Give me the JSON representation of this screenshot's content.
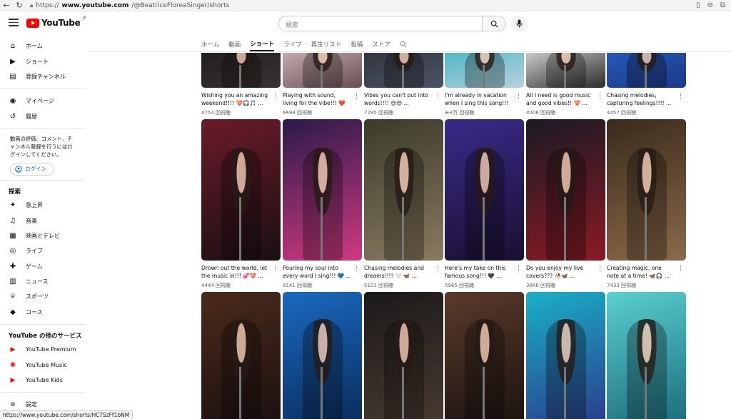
{
  "browser": {
    "url_prefix": "https://",
    "url_host": "www.youtube.com",
    "url_path": "/@BeatriceFloreaSinger/shorts"
  },
  "header": {
    "logo_text": "YouTube",
    "logo_region": "JP",
    "search_placeholder": "検索"
  },
  "sidebar": {
    "main": [
      {
        "label": "ホーム",
        "icon": "home-icon"
      },
      {
        "label": "ショート",
        "icon": "shorts-icon"
      },
      {
        "label": "登録チャンネル",
        "icon": "subscriptions-icon"
      }
    ],
    "you": [
      {
        "label": "マイページ",
        "icon": "account-icon"
      },
      {
        "label": "履歴",
        "icon": "history-icon"
      }
    ],
    "signin_note": "動画の評価、コメント、チャンネル登録を行うにはログインしてください。",
    "login_label": "ログイン",
    "explore_heading": "探索",
    "explore": [
      {
        "label": "急上昇",
        "icon": "trending-icon"
      },
      {
        "label": "音楽",
        "icon": "music-icon"
      },
      {
        "label": "映画とテレビ",
        "icon": "movies-icon"
      },
      {
        "label": "ライブ",
        "icon": "live-icon"
      },
      {
        "label": "ゲーム",
        "icon": "gaming-icon"
      },
      {
        "label": "ニュース",
        "icon": "news-icon"
      },
      {
        "label": "スポーツ",
        "icon": "sports-icon"
      },
      {
        "label": "コース",
        "icon": "courses-icon"
      }
    ],
    "more_heading": "YouTube の他のサービス",
    "more": [
      {
        "label": "YouTube Premium",
        "icon": "youtube-premium-icon"
      },
      {
        "label": "YouTube Music",
        "icon": "youtube-music-icon"
      },
      {
        "label": "YouTube Kids",
        "icon": "youtube-kids-icon"
      }
    ],
    "settings_label": "設定"
  },
  "tabs": [
    {
      "label": "ホーム",
      "active": false
    },
    {
      "label": "動画",
      "active": false
    },
    {
      "label": "ショート",
      "active": true
    },
    {
      "label": "ライブ",
      "active": false
    },
    {
      "label": "再生リスト",
      "active": false
    },
    {
      "label": "投稿",
      "active": false
    },
    {
      "label": "ストア",
      "active": false
    }
  ],
  "shorts_rows": [
    [
      {
        "title": "Wishing you an amazing weekend!!!! 💝🎧🎵 ...",
        "views": "4754 回視聴",
        "c1": "#1a1a1a",
        "c2": "#3a3232"
      },
      {
        "title": "Playing with sound, living for the vibe!!! ❤️ ...",
        "views": "5598 回視聴",
        "c1": "#d8c0c4",
        "c2": "#6a4e52"
      },
      {
        "title": "Vibes you can't put into words!!!! 😍😍 ...",
        "views": "7295 回視聴",
        "c1": "#2e2e34",
        "c2": "#4a5466"
      },
      {
        "title": "I'm already in vacation when I sing this song!!! ...",
        "views": "1.3万 回視聴",
        "c1": "#3ab0c6",
        "c2": "#b8d2da"
      },
      {
        "title": "All I need is good music and good vibes!! 💝 ...",
        "views": "4006 回視聴",
        "c1": "#f0f0f0",
        "c2": "#2a2a2a"
      },
      {
        "title": "Chasing melodies, capturing feelings!!!! ...",
        "views": "4457 回視聴",
        "c1": "#2a5fc0",
        "c2": "#1a3a8a"
      }
    ],
    [
      {
        "title": "Drown out the world, let the music in!!! 💞💝 ...",
        "views": "4444 回視聴",
        "c1": "#6a1a2a",
        "c2": "#1a1012"
      },
      {
        "title": "Pouring my soul into every word I sing!!! 💙 ...",
        "views": "8141 回視聴",
        "c1": "#2a1a4a",
        "c2": "#d03a80"
      },
      {
        "title": "Chasing melodies and dreams!!!! 🤍 🦋 ...",
        "views": "5101 回視聴",
        "c1": "#3a3a2a",
        "c2": "#8a7a60"
      },
      {
        "title": "Here's my take on this famous song!!! 🖤 ...",
        "views": "5985 回視聴",
        "c1": "#3a2a8a",
        "c2": "#1a1030"
      },
      {
        "title": "Do you enjoy my live covers??? 🥀🦋 ...",
        "views": "3666 回視聴",
        "c1": "#1a1a24",
        "c2": "#8a1a24"
      },
      {
        "title": "Creating magic, one note at a time! 🦋🎧 ...",
        "views": "7433 回視聴",
        "c1": "#3a2a1a",
        "c2": "#8a6a4a"
      }
    ],
    [
      {
        "title": "",
        "views": "",
        "c1": "#4a2a1a",
        "c2": "#1a1010"
      },
      {
        "title": "",
        "views": "",
        "c1": "#1a6ac0",
        "c2": "#0a2a5a"
      },
      {
        "title": "",
        "views": "",
        "c1": "#1a1a1a",
        "c2": "#4a3a30"
      },
      {
        "title": "",
        "views": "",
        "c1": "#5a3a2a",
        "c2": "#1a1210"
      },
      {
        "title": "",
        "views": "",
        "c1": "#1ab0c8",
        "c2": "#2a3a8a"
      },
      {
        "title": "",
        "views": "",
        "c1": "#5ad0d0",
        "c2": "#1a6a7a"
      }
    ]
  ],
  "status_url": "https://www.youtube.com/shorts/HCTSzFf1bNM"
}
